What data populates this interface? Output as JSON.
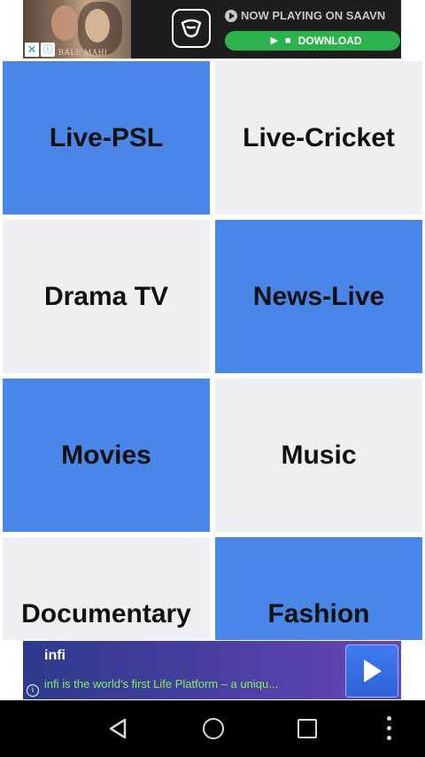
{
  "top_ad": {
    "now_playing": "NOW PLAYING ON SAAVN",
    "download_label": "DOWNLOAD",
    "caption": "BALU MAHI",
    "close_glyph": "✕",
    "info_glyph": "ⓘ",
    "platform_icons": [
      "apple-icon",
      "play-store-icon",
      "windows-icon"
    ]
  },
  "tiles": [
    {
      "label": "Live-PSL",
      "color": "#4a86e8"
    },
    {
      "label": "Live-Cricket",
      "color": "#eeeff3"
    },
    {
      "label": "Drama TV",
      "color": "#eeeff3"
    },
    {
      "label": "News-Live",
      "color": "#4a86e8"
    },
    {
      "label": "Movies",
      "color": "#4a86e8"
    },
    {
      "label": "Music",
      "color": "#eeeff3"
    },
    {
      "label": "Documentary",
      "color": "#eeeff3"
    },
    {
      "label": "Fashion",
      "color": "#4a86e8"
    }
  ],
  "bottom_ad": {
    "title": "infi",
    "description": "infi is the world's first Life Platform – a uniqu...",
    "info_glyph": "i"
  },
  "navbar": {
    "buttons": [
      "back",
      "home",
      "recents",
      "menu"
    ]
  }
}
